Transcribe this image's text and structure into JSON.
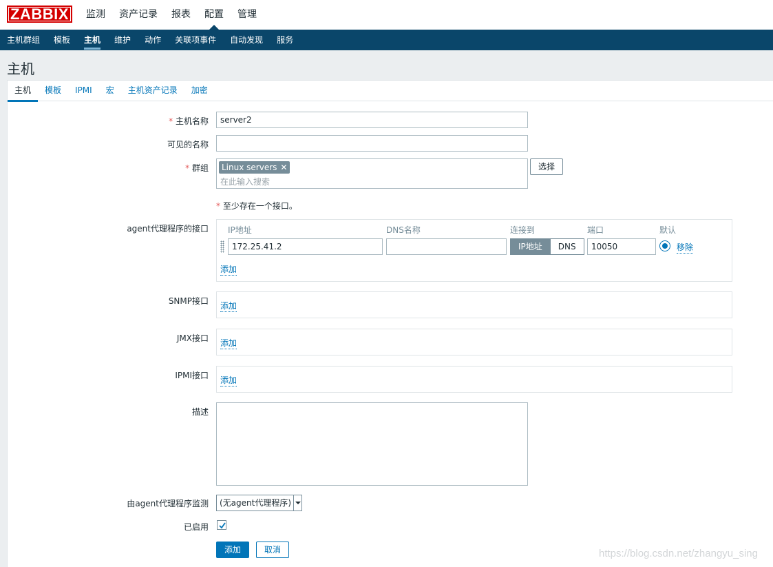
{
  "logo": "ZABBIX",
  "main_menu": [
    "监测",
    "资产记录",
    "报表",
    "配置",
    "管理"
  ],
  "main_menu_active": "配置",
  "sub_menu": [
    "主机群组",
    "模板",
    "主机",
    "维护",
    "动作",
    "关联项事件",
    "自动发现",
    "服务"
  ],
  "sub_menu_active": "主机",
  "page_title": "主机",
  "tabs": [
    "主机",
    "模板",
    "IPMI",
    "宏",
    "主机资产记录",
    "加密"
  ],
  "form": {
    "host_name_label": "主机名称",
    "host_name_value": "server2",
    "visible_name_label": "可见的名称",
    "visible_name_value": "",
    "groups_label": "群组",
    "group_tag": "Linux servers",
    "groups_placeholder": "在此输入搜索",
    "select_button": "选择",
    "interface_note": "至少存在一个接口。",
    "agent_label": "agent代理程序的接口",
    "col_ip": "IP地址",
    "col_dns": "DNS名称",
    "col_connect": "连接到",
    "col_port": "端口",
    "col_default": "默认",
    "ip_value": "172.25.41.2",
    "dns_value": "",
    "connect_ip": "IP地址",
    "connect_dns": "DNS",
    "port_value": "10050",
    "remove_link": "移除",
    "add_link": "添加",
    "snmp_label": "SNMP接口",
    "jmx_label": "JMX接口",
    "ipmi_label": "IPMI接口",
    "desc_label": "描述",
    "proxy_label": "由agent代理程序监测",
    "proxy_value": "(无agent代理程序)",
    "enabled_label": "已启用",
    "enabled": true,
    "submit_button": "添加",
    "cancel_button": "取消"
  },
  "watermark": "https://blog.csdn.net/zhangyu_sing",
  "colors": {
    "accent": "#0275b8",
    "nav": "#0a466a",
    "logo": "#d40000"
  }
}
